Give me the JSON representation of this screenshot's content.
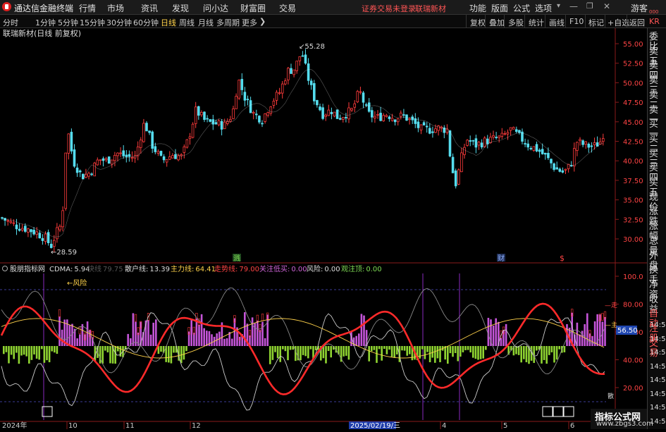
{
  "app": {
    "title": "通达信金融终端"
  },
  "menu": [
    "行情",
    "市场",
    "资讯",
    "发现",
    "问小达",
    "财富圈",
    "交易"
  ],
  "status": {
    "login": "证券交易未登录",
    "stock": "联瑞新材"
  },
  "right_menu": [
    "功能",
    "版面",
    "公式",
    "选项"
  ],
  "user": "游客",
  "timeframes": [
    "分时",
    "1分钟",
    "5分钟",
    "15分钟",
    "30分钟",
    "60分钟",
    "日线",
    "周线",
    "月线",
    "多周期",
    "更多"
  ],
  "timeframe_active": "日线",
  "toolbar_right": [
    "复权",
    "叠加",
    "多股",
    "统计",
    "画线",
    "F10",
    "标记",
    "+自选",
    "返回"
  ],
  "chart_title": "联瑞新材(日线 前复权)",
  "price_axis": [
    "55.00",
    "52.50",
    "50.00",
    "47.50",
    "45.00",
    "42.50",
    "40.00",
    "37.50",
    "35.00",
    "32.50",
    "30.00"
  ],
  "price_high": "55.28",
  "price_low": "28.59",
  "event_markers": [
    "溅",
    "财",
    "$"
  ],
  "indicator": {
    "name": "股朋指标网",
    "cdma_label": "CDMA:",
    "cdma_value": "5.94",
    "k_label": "快线",
    "k_value": "79.75",
    "retail_label": "散户线:",
    "retail_value": "13.39",
    "main_label": "主力线:",
    "main_value": "64.41",
    "trend_label": "走势线:",
    "trend_value": "79.00",
    "buy_label": "关注低买:",
    "buy_value": "0.00",
    "risk_label": "风险:",
    "risk_value": "0.00",
    "top_label": "观注顶:",
    "top_value": "0.00",
    "risk_note": "←风险",
    "axis": [
      "100.0",
      "80.00",
      "60.00",
      "40.00",
      "20.00"
    ],
    "tag_value": "56.50",
    "tag_main": "主",
    "tag_zou": "走",
    "tag_san": "散"
  },
  "date_axis": [
    "2024年",
    "10",
    "11",
    "12",
    "2025/02/19/三",
    "4",
    "5",
    "6"
  ],
  "right_panel": {
    "top_code": "KR",
    "top_sub": "000",
    "items": [
      "委比",
      "卖五",
      "卖四",
      "卖三",
      "卖二",
      "卖一",
      "买一",
      "买二",
      "买三",
      "买四",
      "买五",
      "现价",
      "涨跌",
      "涨幅",
      "总量",
      "外盘",
      "换手",
      "净资",
      "收益",
      "自动",
      "注册",
      "交易"
    ],
    "times": [
      "14:50",
      "14:50",
      "14:50",
      "14:50",
      "14:50",
      "14:50",
      "14:50",
      "14:50"
    ]
  },
  "watermark": {
    "title": "指标公式网",
    "url": "www.zbgs3.com"
  },
  "colors": {
    "up": "#ff3b3b",
    "down": "#55ddee",
    "ma": "#ffffff",
    "yellow": "#ffd24a",
    "purple": "#c455d8",
    "green": "#8fd431"
  }
}
